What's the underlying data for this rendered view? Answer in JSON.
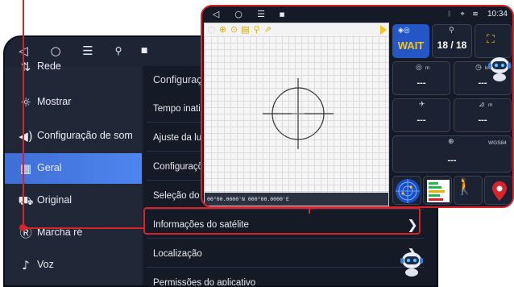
{
  "settings": {
    "sidebar": {
      "items": [
        {
          "label": "Rede",
          "icon": "network-icon"
        },
        {
          "label": "Mostrar",
          "icon": "brightness-icon"
        },
        {
          "label": "Configuração de som",
          "icon": "speaker-icon"
        },
        {
          "label": "Geral",
          "icon": "grid-icon",
          "active": true
        },
        {
          "label": "Original",
          "icon": "car-icon"
        },
        {
          "label": "Marcha ré",
          "icon": "reverse-gear-icon"
        },
        {
          "label": "Voz",
          "icon": "microphone-icon"
        }
      ]
    },
    "main": {
      "title": "Configuraçõe",
      "rows": [
        {
          "label": "Tempo inativ"
        },
        {
          "label": "Ajuste da luz"
        },
        {
          "label": "Configuraçõe"
        },
        {
          "label": "Seleção do aplicativo do gravador"
        },
        {
          "label": "Informações do satélite",
          "highlighted": true
        },
        {
          "label": "Localização"
        },
        {
          "label": "Permissões do aplicativo"
        }
      ]
    }
  },
  "satellite": {
    "clock": "10:34",
    "coordinates": "00°00.0000'N   000°00.0000'E",
    "status": "WAIT",
    "satellites": "18 / 18",
    "altitude_unit": "m",
    "speed_unit": "km/h",
    "heading_value": "---",
    "accuracy_unit": "m",
    "datum": "WGS84",
    "values": {
      "altitude": "---",
      "speed": "---",
      "heading": "---",
      "accuracy": "---",
      "position": "---"
    }
  },
  "colors": {
    "accent_red": "#d8232a",
    "active_blue": "#3e6fd6",
    "status_yellow": "#f5c518"
  }
}
